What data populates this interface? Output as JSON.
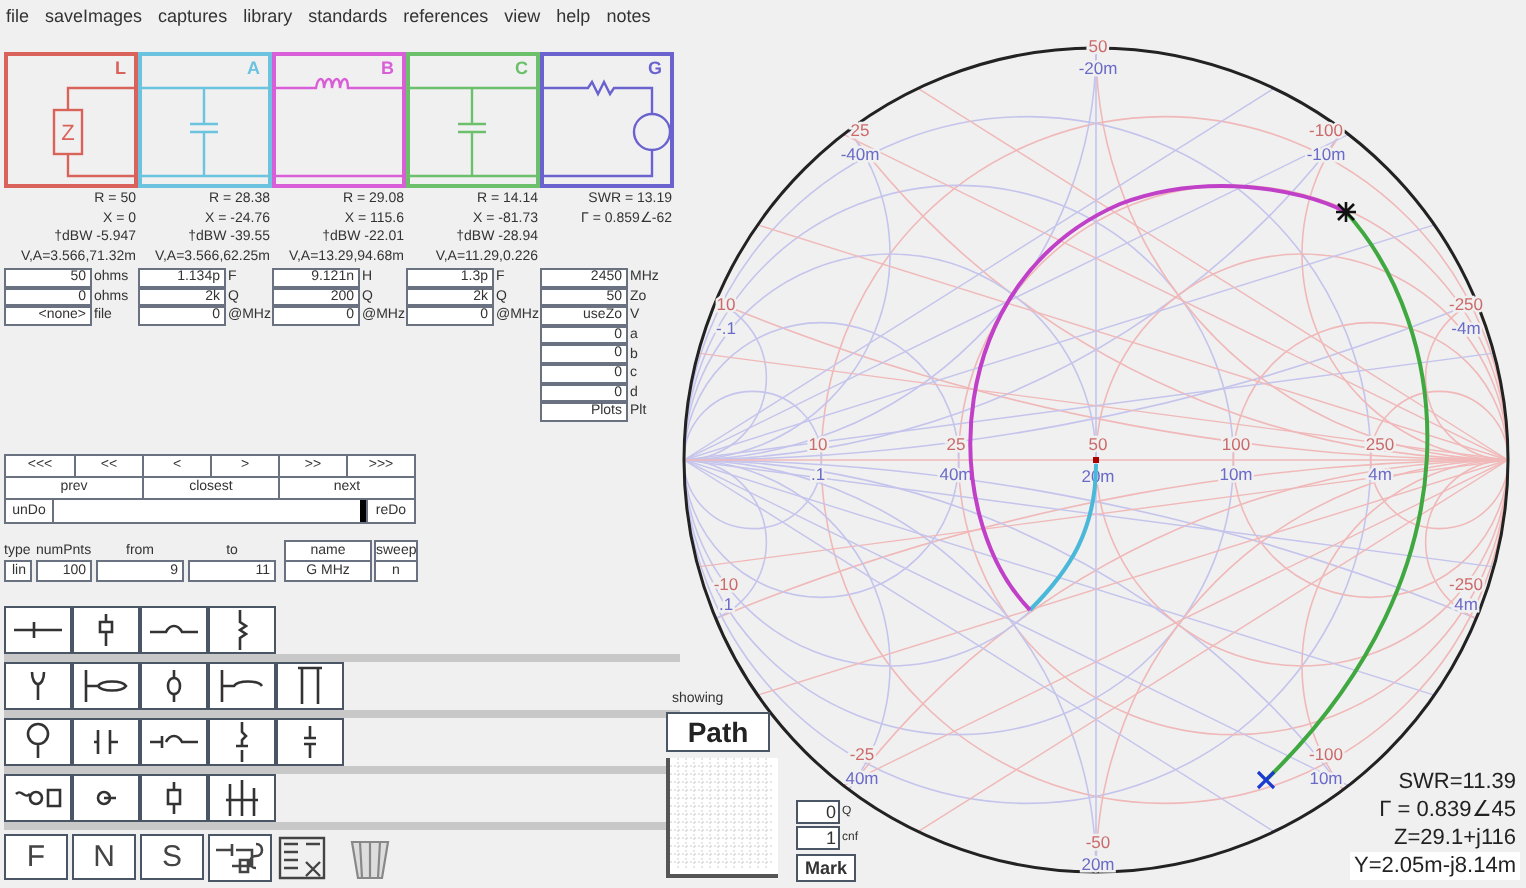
{
  "menu": [
    "file",
    "saveImages",
    "captures",
    "library",
    "standards",
    "references",
    "view",
    "help",
    "notes"
  ],
  "stages": [
    {
      "label": "L",
      "kind": "load",
      "symbol": "Z",
      "color": "#d9635b",
      "readouts": [
        "R = 50",
        "X = 0",
        "†dBW -5.947",
        "V,A=3.566,71.32m"
      ],
      "fields": [
        {
          "value": "50",
          "unit": "ohms"
        },
        {
          "value": "0",
          "unit": "ohms"
        },
        {
          "value": "<none>",
          "unit": "file"
        }
      ]
    },
    {
      "label": "A",
      "kind": "shunt",
      "color": "#6cc3e0",
      "readouts": [
        "R = 28.38",
        "X = -24.76",
        "†dBW -39.55",
        "V,A=3.566,62.25m"
      ],
      "fields": [
        {
          "value": "1.134p",
          "unit": "F"
        },
        {
          "value": "2k",
          "unit": "Q"
        },
        {
          "value": "0",
          "unit": "@MHz"
        }
      ]
    },
    {
      "label": "B",
      "kind": "series",
      "color": "#d95fd9",
      "readouts": [
        "R = 29.08",
        "X = 115.6",
        "†dBW -22.01",
        "V,A=13.29,94.68m"
      ],
      "fields": [
        {
          "value": "9.121n",
          "unit": "H"
        },
        {
          "value": "200",
          "unit": "Q"
        },
        {
          "value": "0",
          "unit": "@MHz"
        }
      ]
    },
    {
      "label": "C",
      "kind": "shunt",
      "color": "#6cc06c",
      "readouts": [
        "R = 14.14",
        "X = -81.73",
        "†dBW -28.94",
        "V,A=11.29,0.226"
      ],
      "fields": [
        {
          "value": "1.3p",
          "unit": "F"
        },
        {
          "value": "2k",
          "unit": "Q"
        },
        {
          "value": "0",
          "unit": "@MHz"
        }
      ]
    },
    {
      "label": "G",
      "kind": "source",
      "color": "#6a63cf",
      "readouts": [
        "SWR = 13.19",
        "Γ = 0.859∠-62"
      ],
      "fields": [
        {
          "value": "2450",
          "unit": "MHz"
        },
        {
          "value": "50",
          "unit": "Zo"
        },
        {
          "value": "useZo",
          "unit": "V"
        },
        {
          "value": "0",
          "unit": "a"
        },
        {
          "value": "0",
          "unit": "b"
        },
        {
          "value": "0",
          "unit": "c"
        },
        {
          "value": "0",
          "unit": "d"
        },
        {
          "value": "Plots",
          "unit": "Plt"
        }
      ]
    }
  ],
  "navigation": {
    "steps": [
      "<<<",
      "<<",
      "<",
      ">",
      ">>",
      ">>>"
    ],
    "jumps": [
      "prev",
      "closest",
      "next"
    ],
    "undo": "unDo",
    "redo": "reDo",
    "history": {
      "level": 1
    }
  },
  "sweep": {
    "fields": [
      {
        "label": "type",
        "value": "lin"
      },
      {
        "label": "numPnts",
        "value": "100"
      },
      {
        "label": "from",
        "value": "9"
      },
      {
        "label": "to",
        "value": "11"
      }
    ],
    "buttons": [
      {
        "label": "name",
        "value": "G MHz"
      },
      {
        "label": "sweep",
        "value": "n"
      }
    ]
  },
  "palette_tabs": [
    "F",
    "N",
    "S"
  ],
  "chart": {
    "labels": [
      {
        "text": "50",
        "kind": "r"
      },
      {
        "text": "-20m",
        "kind": "g"
      },
      {
        "text": "25",
        "kind": "r"
      },
      {
        "text": "-40m",
        "kind": "g"
      },
      {
        "text": "-100",
        "kind": "r"
      },
      {
        "text": "-10m",
        "kind": "g"
      },
      {
        "text": "10",
        "kind": "r"
      },
      {
        "text": "-.1",
        "kind": "g"
      },
      {
        "text": "-250",
        "kind": "r"
      },
      {
        "text": "-4m",
        "kind": "g"
      },
      {
        "text": "10",
        "kind": "r"
      },
      {
        "text": ".1",
        "kind": "g"
      },
      {
        "text": "25",
        "kind": "r"
      },
      {
        "text": "40m",
        "kind": "g"
      },
      {
        "text": "50",
        "kind": "r"
      },
      {
        "text": "20m",
        "kind": "g"
      },
      {
        "text": "100",
        "kind": "r"
      },
      {
        "text": "10m",
        "kind": "g"
      },
      {
        "text": "250",
        "kind": "r"
      },
      {
        "text": "4m",
        "kind": "g"
      },
      {
        "text": "-10",
        "kind": "r"
      },
      {
        "text": ".1",
        "kind": "g"
      },
      {
        "text": "-250",
        "kind": "r"
      },
      {
        "text": "4m",
        "kind": "g"
      },
      {
        "text": "-25",
        "kind": "r"
      },
      {
        "text": "40m",
        "kind": "g"
      },
      {
        "text": "-100",
        "kind": "r"
      },
      {
        "text": "10m",
        "kind": "g"
      },
      {
        "text": "-50",
        "kind": "r"
      },
      {
        "text": "20m",
        "kind": "g"
      }
    ]
  },
  "display": {
    "caption": "showing",
    "mode": "Path",
    "fields": [
      {
        "value": "0",
        "unit": "Q"
      },
      {
        "value": "1",
        "unit": "cnf"
      }
    ],
    "mark": "Mark"
  },
  "readout": [
    "SWR=11.39",
    "Γ = 0.839∠45",
    "Z=29.1+j116",
    "Y=2.05m-j8.14m"
  ]
}
